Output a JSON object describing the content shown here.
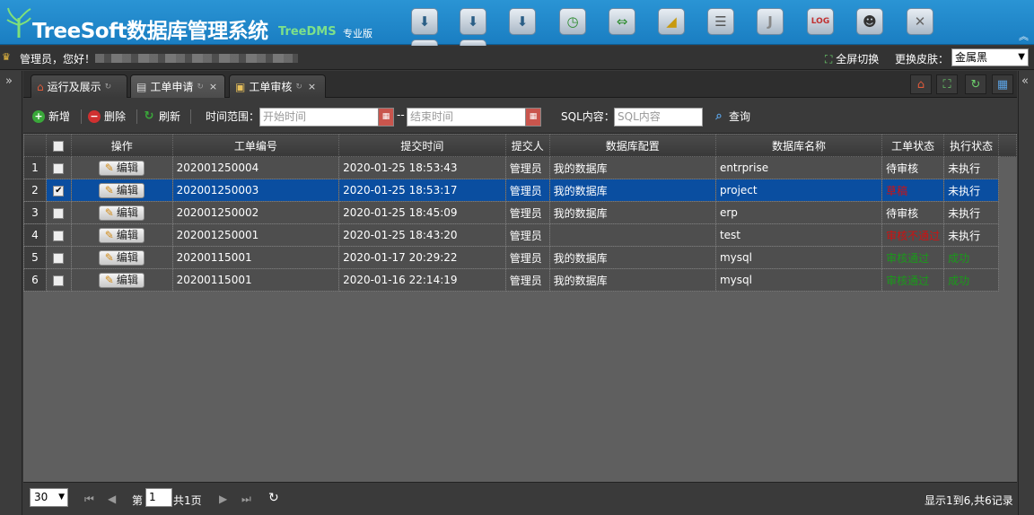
{
  "header": {
    "title": "TreeSoft数据库管理系统",
    "subtitle": "TreeDMS",
    "edition": "专业版",
    "icons": [
      "download-icon",
      "download-icon",
      "download-icon",
      "clock-icon",
      "arrows-icon",
      "chart-icon",
      "database-icon",
      "j-icon",
      "log-icon",
      "user-icon",
      "tools-icon"
    ]
  },
  "userbar": {
    "greeting": "管理员，您好！",
    "fullscreen_label": "全屏切换",
    "skin_label": "更换皮肤：",
    "skin_value": "金属黑"
  },
  "tabs": [
    {
      "label": "运行及展示",
      "icon": "home-icon",
      "active": false
    },
    {
      "label": "工单申请",
      "icon": "document-icon",
      "active": true
    },
    {
      "label": "工单审核",
      "icon": "folder-icon",
      "active": false
    }
  ],
  "toolbar": {
    "add_label": "新增",
    "delete_label": "删除",
    "refresh_label": "刷新",
    "time_range_label": "时间范围：",
    "start_placeholder": "开始时间",
    "separator": "--",
    "end_placeholder": "结束时间",
    "sql_label": "SQL内容：",
    "sql_placeholder": "SQL内容",
    "search_label": "查询"
  },
  "grid": {
    "columns": [
      "操作",
      "工单编号",
      "提交时间",
      "提交人",
      "数据库配置",
      "数据库名称",
      "工单状态",
      "执行状态"
    ],
    "edit_label": "编辑",
    "rows": [
      {
        "num": "1",
        "checked": false,
        "selected": false,
        "id": "202001250004",
        "time": "2020-01-25 18:53:43",
        "user": "管理员",
        "config": "我的数据库",
        "db": "entrprise",
        "status": "待审核",
        "status_color": "#ffffff",
        "exec": "未执行",
        "exec_color": "#ffffff"
      },
      {
        "num": "2",
        "checked": true,
        "selected": true,
        "id": "202001250003",
        "time": "2020-01-25 18:53:17",
        "user": "管理员",
        "config": "我的数据库",
        "db": "project",
        "status": "草稿",
        "status_color": "#d01010",
        "exec": "未执行",
        "exec_color": "#ffffff"
      },
      {
        "num": "3",
        "checked": false,
        "selected": false,
        "id": "202001250002",
        "time": "2020-01-25 18:45:09",
        "user": "管理员",
        "config": "我的数据库",
        "db": "erp",
        "status": "待审核",
        "status_color": "#ffffff",
        "exec": "未执行",
        "exec_color": "#ffffff"
      },
      {
        "num": "4",
        "checked": false,
        "selected": false,
        "id": "202001250001",
        "time": "2020-01-25 18:43:20",
        "user": "管理员",
        "config": "",
        "db": "test",
        "status": "审核不通过",
        "status_color": "#d01010",
        "exec": "未执行",
        "exec_color": "#ffffff"
      },
      {
        "num": "5",
        "checked": false,
        "selected": false,
        "id": "20200115001",
        "time": "2020-01-17 20:29:22",
        "user": "管理员",
        "config": "我的数据库",
        "db": "mysql",
        "status": "审核通过",
        "status_color": "#1a9a1a",
        "exec": "成功",
        "exec_color": "#1a9a1a"
      },
      {
        "num": "6",
        "checked": false,
        "selected": false,
        "id": "20200115001",
        "time": "2020-01-16 22:14:19",
        "user": "管理员",
        "config": "我的数据库",
        "db": "mysql",
        "status": "审核通过",
        "status_color": "#1a9a1a",
        "exec": "成功",
        "exec_color": "#1a9a1a"
      }
    ]
  },
  "pager": {
    "page_size": "30",
    "page_prefix": "第",
    "page_value": "1",
    "page_suffix": "共1页",
    "summary": "显示1到6,共6记录"
  }
}
